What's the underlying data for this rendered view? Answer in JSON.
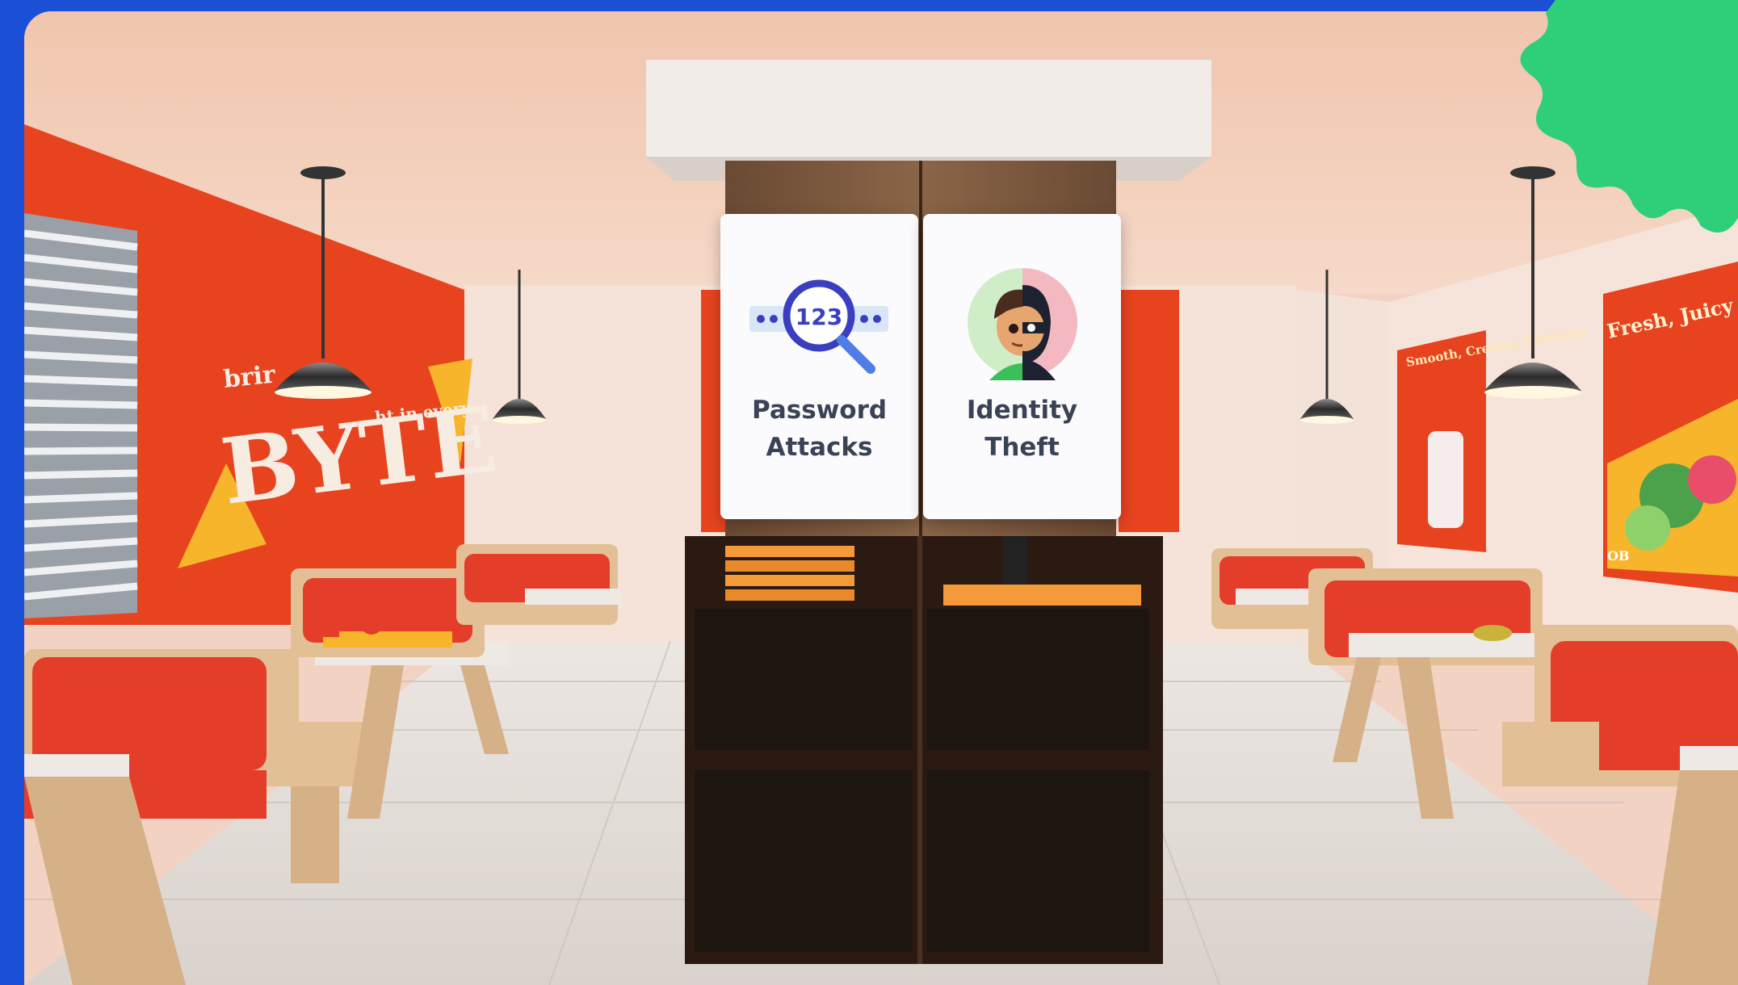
{
  "scene": {
    "name": "Restaurant interior",
    "wall_sign": {
      "line_small_left": "brir",
      "line_small_right": "ht in every",
      "headline": "BYTE"
    },
    "poster_small": {
      "text": "Smooth, Creamy, Delicious"
    },
    "poster_large": {
      "text": "Fresh, Juicy & Bursting",
      "tag": "OB"
    }
  },
  "cards": [
    {
      "id": "password-attacks",
      "line1": "Password",
      "line2": "Attacks",
      "icon": "magnifier-123-icon",
      "icon_text": "123"
    },
    {
      "id": "identity-theft",
      "line1": "Identity",
      "line2": "Theft",
      "icon": "split-face-hacker-icon"
    }
  ],
  "colors": {
    "frame": "#1a4fd6",
    "accent_wall": "#e8431f",
    "splat": "#2fcf7a",
    "card_text": "#3a4356",
    "icon_blue": "#3a3fbf"
  }
}
